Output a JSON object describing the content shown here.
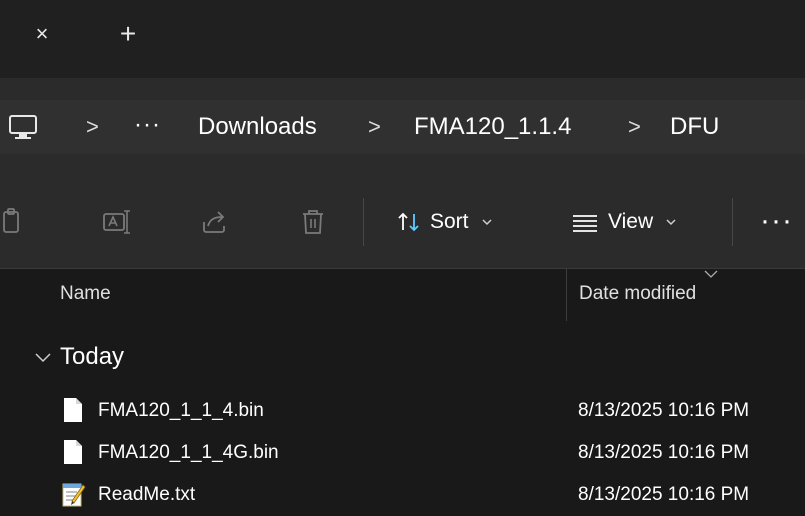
{
  "tabbar": {
    "close_glyph": "×",
    "new_tab_glyph": "+"
  },
  "address_bar": {
    "root_icon": "computer-icon",
    "overflow": "···",
    "separator": ">",
    "crumbs": [
      "Downloads",
      "FMA120_1.1.4",
      "DFU"
    ]
  },
  "toolbar": {
    "icons": [
      "paste-icon",
      "rename-icon",
      "share-icon",
      "delete-icon"
    ],
    "sort_label": "Sort",
    "view_label": "View",
    "more_glyph": "···"
  },
  "file_list": {
    "columns": {
      "name": "Name",
      "date": "Date modified"
    },
    "groups": [
      {
        "label": "Today",
        "files": [
          {
            "name": "FMA120_1_1_4.bin",
            "date": "8/13/2025 10:16 PM",
            "icon": "file-icon"
          },
          {
            "name": "FMA120_1_1_4G.bin",
            "date": "8/13/2025 10:16 PM",
            "icon": "file-icon"
          },
          {
            "name": "ReadMe.txt",
            "date": "8/13/2025 10:16 PM",
            "icon": "notepad-icon"
          }
        ]
      }
    ]
  },
  "colors": {
    "background": "#191919",
    "toolbar": "#2b2b2b",
    "tabbar": "#202020",
    "sort_accent": "#60cdff"
  }
}
